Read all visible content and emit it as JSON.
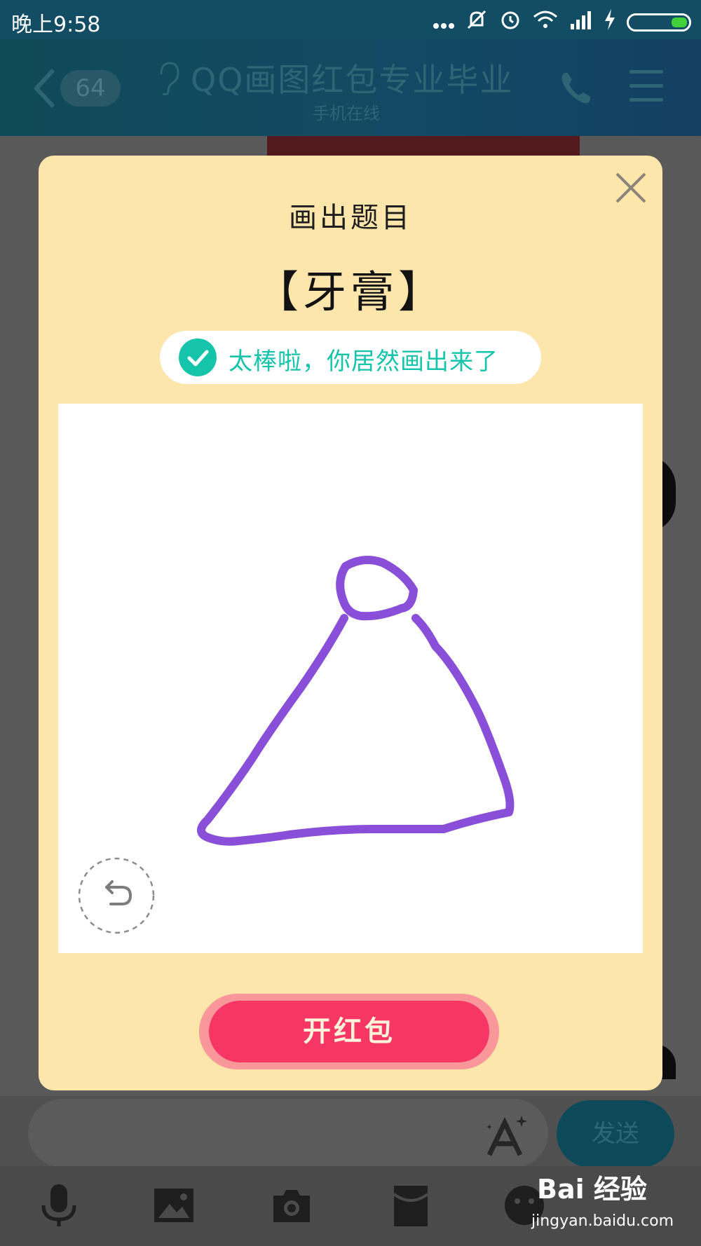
{
  "status_bar": {
    "time": "晚上9:58",
    "icons": [
      "more-dots-icon",
      "mute-bell-icon",
      "alarm-icon",
      "wifi-icon",
      "signal-icon",
      "charging-icon",
      "battery-icon"
    ]
  },
  "header": {
    "unread_count": "64",
    "title": "QQ画图红包专业毕业",
    "subtitle": "手机在线"
  },
  "dialog": {
    "title": "画出题目",
    "prompt_word": "【牙膏】",
    "success_message": "太棒啦，你居然画出来了",
    "open_button_label": "开红包",
    "stroke_color": "#8a4fd8"
  },
  "input_bar": {
    "send_label": "发送"
  },
  "toolbar": {
    "items": [
      "microphone-icon",
      "image-icon",
      "camera-icon",
      "red-packet-icon",
      "emoji-icon"
    ]
  },
  "watermark": {
    "main": "Bai 经验",
    "sub": "jingyan.baidu.com"
  },
  "colors": {
    "modal_bg": "#fce6ab",
    "success_green": "#16c3ab",
    "open_button": "#f63766",
    "header_bg": "#124a63"
  }
}
